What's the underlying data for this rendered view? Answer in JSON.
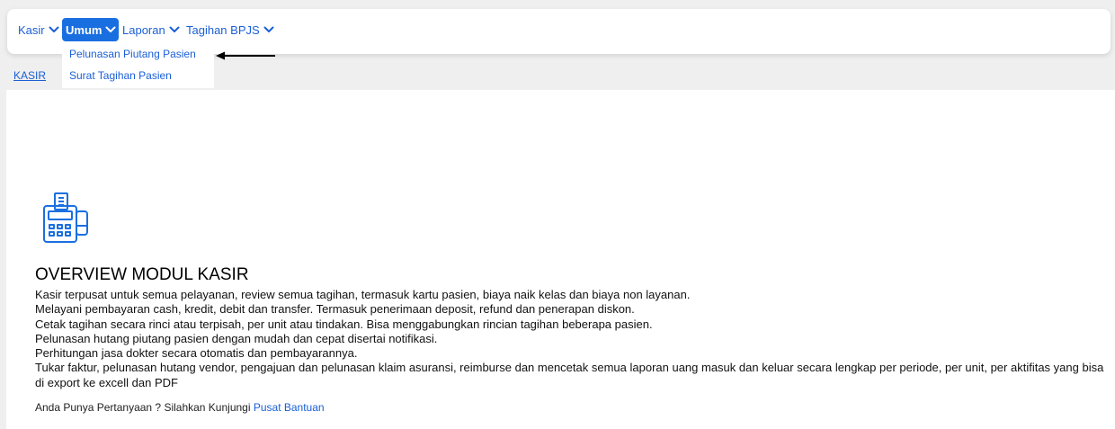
{
  "nav": {
    "items": [
      {
        "label": "Kasir"
      },
      {
        "label": "Umum"
      },
      {
        "label": "Laporan"
      },
      {
        "label": "Tagihan BPJS"
      }
    ],
    "active": "Umum"
  },
  "dropdown": {
    "items": [
      {
        "label": "Pelunasan Piutang Pasien"
      },
      {
        "label": "Surat Tagihan Pasien"
      }
    ]
  },
  "breadcrumb": {
    "label": "KASIR"
  },
  "overview": {
    "title": "OVERVIEW MODUL KASIR",
    "lines": [
      "Kasir terpusat untuk semua pelayanan, review semua tagihan, termasuk kartu pasien, biaya naik kelas dan biaya non layanan.",
      "Melayani pembayaran cash, kredit, debit dan transfer. Termasuk penerimaan deposit, refund dan penerapan diskon.",
      "Cetak tagihan secara rinci atau terpisah, per unit atau tindakan. Bisa menggabungkan rincian tagihan beberapa pasien.",
      "Pelunasan hutang piutang pasien dengan mudah dan cepat disertai notifikasi.",
      "Perhitungan jasa dokter secara otomatis dan pembayarannya.",
      "Tukar faktur, pelunasan hutang vendor, pengajuan dan pelunasan klaim asuransi, reimburse dan mencetak semua laporan uang masuk dan keluar secara lengkap per periode, per unit, per aktifitas yang bisa di export ke excell dan PDF"
    ]
  },
  "help": {
    "text": "Anda Punya Pertanyaan ? Silahkan Kunjungi ",
    "link_label": "Pusat Bantuan"
  },
  "colors": {
    "accent": "#1a6fe0",
    "link": "#1a5fd6",
    "background": "#efefef"
  },
  "icons": {
    "nav_chevron": "chevron-down-icon",
    "kasir": "cash-register-icon",
    "pointer": "arrow-left-icon"
  }
}
